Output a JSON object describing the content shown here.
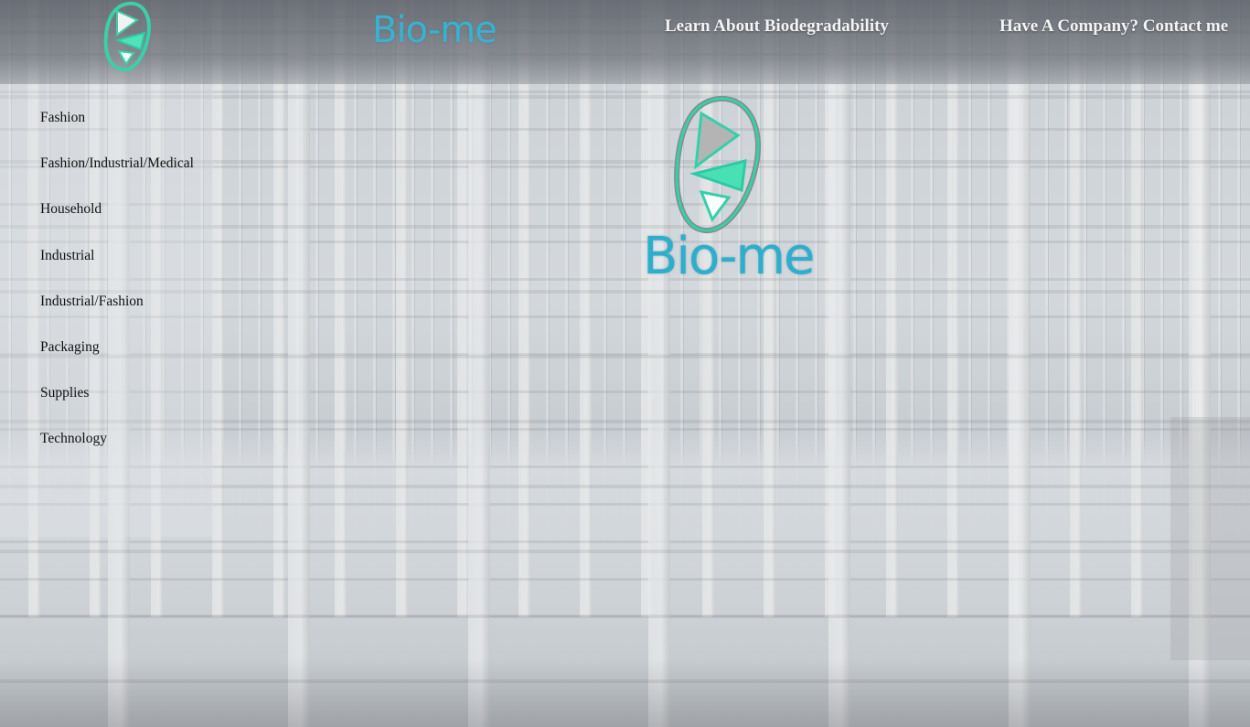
{
  "header": {
    "brand": "Bio-me",
    "nav": [
      {
        "label": "Learn About Biodegradability"
      },
      {
        "label": "Have A Company? Contact me"
      }
    ]
  },
  "sidebar": {
    "categories": [
      {
        "label": "Fashion"
      },
      {
        "label": "Fashion/Industrial/Medical"
      },
      {
        "label": "Household"
      },
      {
        "label": "Industrial"
      },
      {
        "label": "Industrial/Fashion"
      },
      {
        "label": "Packaging"
      },
      {
        "label": "Supplies"
      },
      {
        "label": "Technology"
      }
    ]
  },
  "hero": {
    "brand": "Bio-me"
  },
  "colors": {
    "brand_teal": "#2eaecd",
    "logo_mint": "#4fe3b8",
    "logo_outline": "#2ec9a6",
    "logo_grey": "#b0b0b0"
  },
  "icons": {
    "header_logo": "bio-me-logo-icon",
    "hero_logo": "bio-me-logo-icon"
  }
}
